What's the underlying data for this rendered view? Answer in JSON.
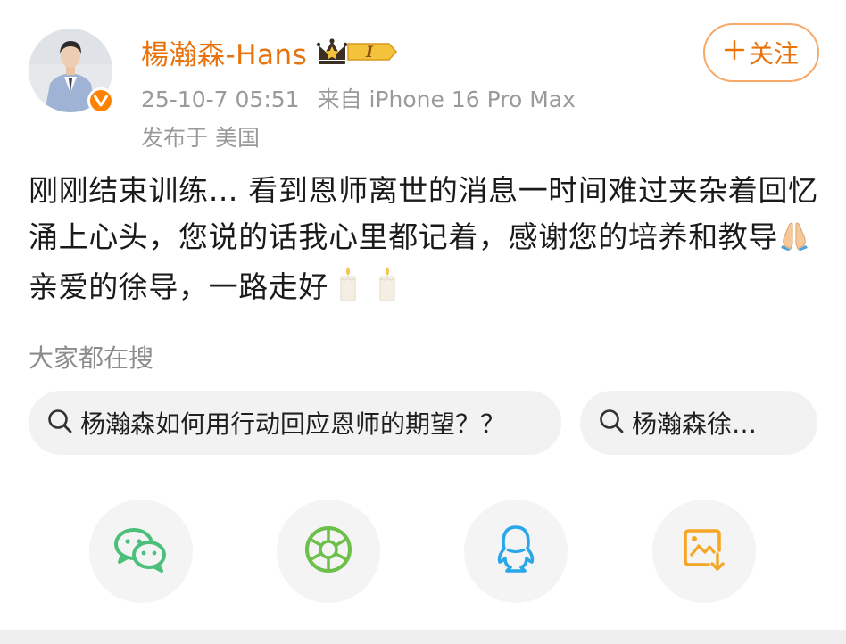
{
  "header": {
    "username": "楊瀚森-Hans",
    "vip_level": "I",
    "timestamp": "25-10-7 05:51",
    "source": "来自 iPhone 16 Pro Max",
    "location": "发布于 美国",
    "follow_label": "关注"
  },
  "post": {
    "text_before_hands": "刚刚结束训练… 看到恩师离世的消息一时间难过夹杂着回忆涌上心头，您说的话我心里都记着，感谢您的培养和教导",
    "text_after_hands": " 亲爱的徐导，一路走好"
  },
  "search": {
    "title": "大家都在搜",
    "items": [
      {
        "label": "杨瀚森如何用行动回应恩师的期望？？"
      },
      {
        "label": "杨瀚森徐…"
      }
    ]
  },
  "share": {
    "icons": [
      "wechat-icon",
      "moments-icon",
      "qq-icon",
      "save-image-icon"
    ]
  },
  "colors": {
    "brand_orange": "#e8720c",
    "follow_border": "#f7a96a",
    "verified_orange": "#ff8200",
    "wechat_green": "#4cc07a",
    "moments_green": "#6cc04a",
    "qq_blue": "#2aa7e8",
    "save_orange": "#f5a623"
  }
}
